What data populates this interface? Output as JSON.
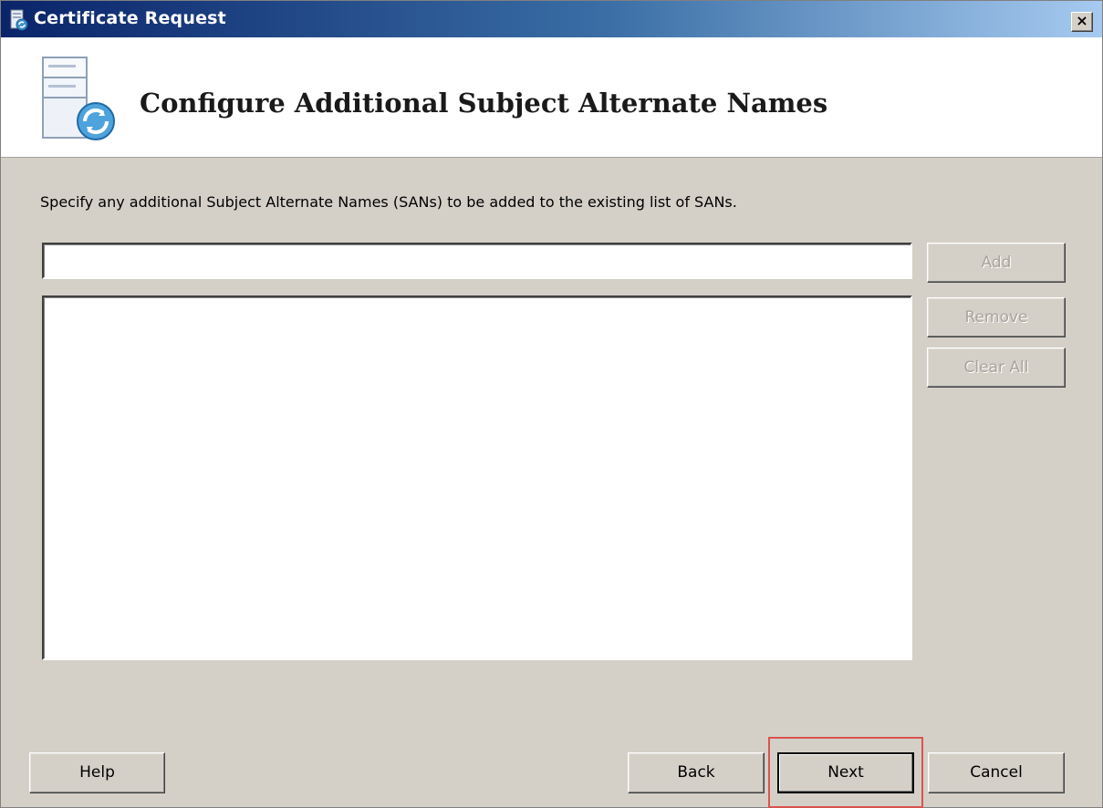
{
  "window": {
    "title": "Certificate Request",
    "close_label": "×"
  },
  "header": {
    "title": "Configure Additional Subject Alternate Names"
  },
  "content": {
    "instruction": "Specify any additional Subject Alternate Names (SANs) to be added to the existing list of SANs.",
    "san_input_value": "",
    "san_list_items": []
  },
  "side_buttons": {
    "add": "Add",
    "remove": "Remove",
    "clear_all": "Clear All"
  },
  "footer": {
    "help": "Help",
    "back": "Back",
    "next": "Next",
    "cancel": "Cancel"
  },
  "colors": {
    "titlebar_start": "#0a246a",
    "titlebar_end": "#a6caf0",
    "dialog_bg": "#d4d0c8",
    "highlight": "#d9534f"
  }
}
